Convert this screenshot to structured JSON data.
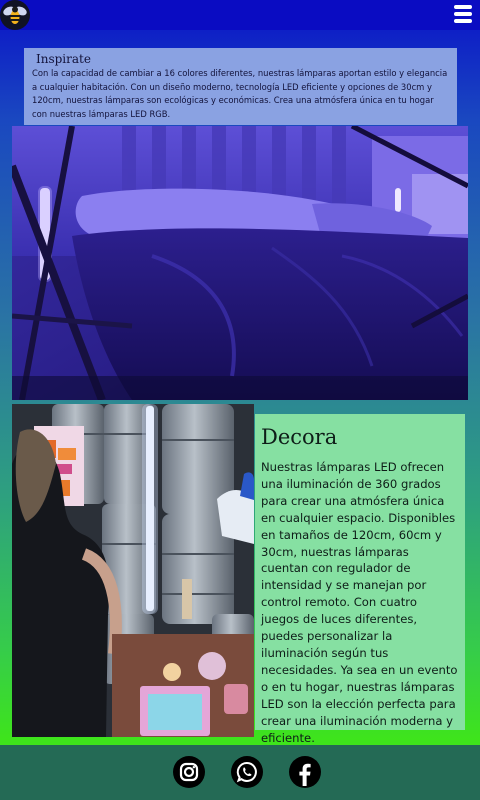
{
  "header": {
    "logo_icon": "bee-icon",
    "menu_icon": "hamburger-menu-icon",
    "background": "#0a0cc2"
  },
  "inspire": {
    "title": "Inspirate",
    "text": "Con la capacidad de cambiar a 16 colores diferentes, nuestras lámparas aportan estilo y elegancia a cualquier habitación. Con un diseño moderno, tecnología LED eficiente y opciones de 30cm y 120cm, nuestras lámparas son ecológicas y económicas. Crea una atmósfera única en tu hogar con nuestras lámparas LED RGB."
  },
  "decora": {
    "title": "Decora",
    "text": "Nuestras lámparas LED ofrecen una iluminación de 360 grados para crear una atmósfera única en cualquier espacio. Disponibles en tamaños de 120cm, 60cm y 30cm, nuestras lámparas cuentan con regulador de intensidad y se manejan por control remoto. Con cuatro juegos de luces diferentes, puedes personalizar la iluminación según tus necesidades. Ya sea en un evento o en tu hogar, nuestras lámparas LED son la elección perfecta para crear una iluminación moderna y eficiente."
  },
  "footer": {
    "social": [
      {
        "icon": "instagram-icon"
      },
      {
        "icon": "whatsapp-icon"
      },
      {
        "icon": "facebook-icon"
      }
    ],
    "background": "#246a55"
  },
  "colors": {
    "inspire_card": "#8aa2e2",
    "decora_card": "#86e0a2",
    "gradient_top": "#0a12c8",
    "gradient_bottom": "#3ee41c"
  }
}
